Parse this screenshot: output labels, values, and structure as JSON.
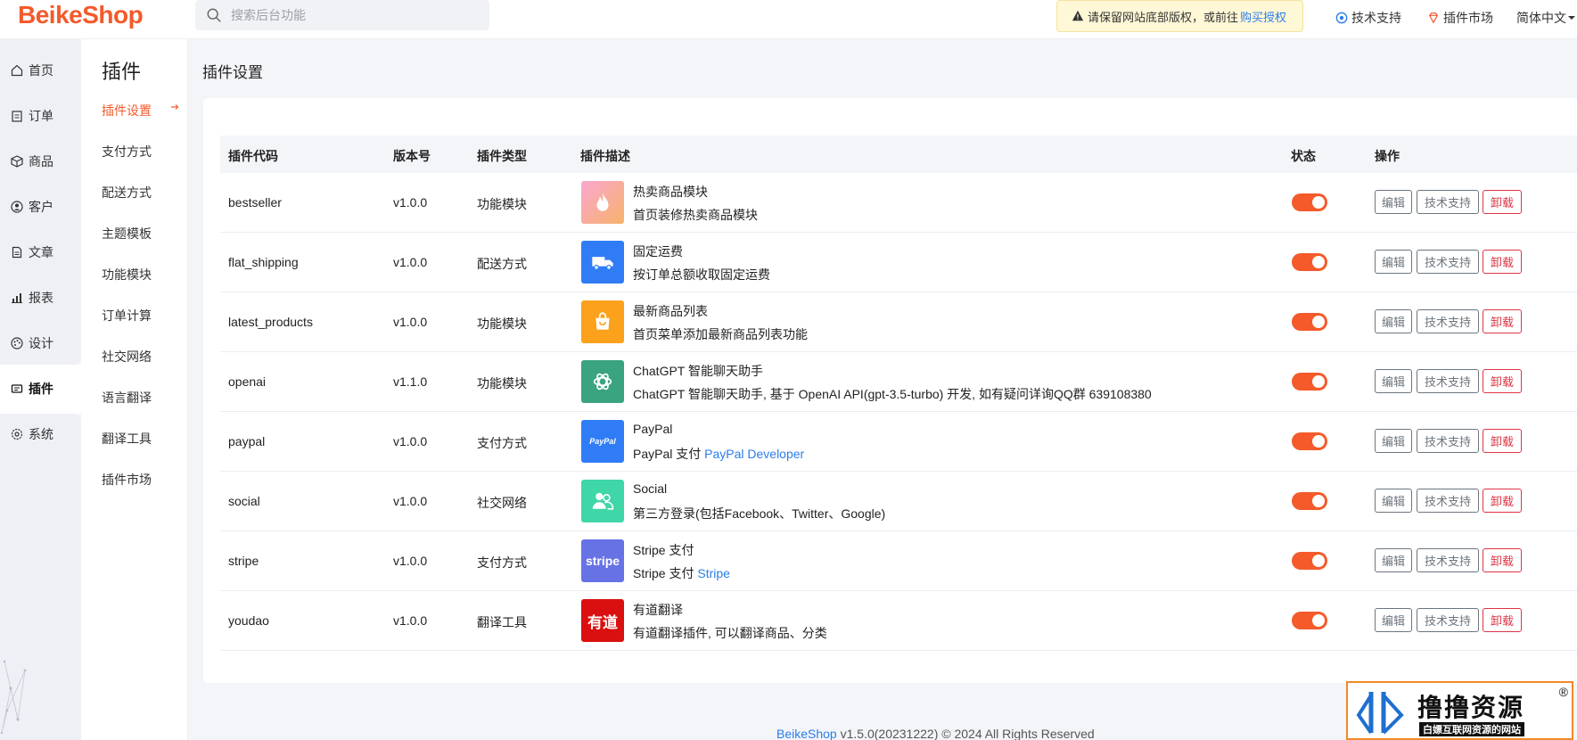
{
  "header": {
    "logo": "BeikeShop",
    "search_placeholder": "搜索后台功能",
    "notice_text": "请保留网站底部版权，或前往",
    "notice_link": "购买授权",
    "support": "技术支持",
    "market": "插件市场",
    "language": "简体中文"
  },
  "sidebar": {
    "items": [
      {
        "label": "首页",
        "icon": "home-icon"
      },
      {
        "label": "订单",
        "icon": "clipboard-icon"
      },
      {
        "label": "商品",
        "icon": "box-icon"
      },
      {
        "label": "客户",
        "icon": "user-icon"
      },
      {
        "label": "文章",
        "icon": "document-icon"
      },
      {
        "label": "报表",
        "icon": "bar-chart-icon"
      },
      {
        "label": "设计",
        "icon": "palette-icon"
      },
      {
        "label": "插件",
        "icon": "plugin-icon"
      },
      {
        "label": "系统",
        "icon": "gear-icon"
      }
    ],
    "active": "插件"
  },
  "subnav": {
    "title": "插件",
    "items": [
      "插件设置",
      "支付方式",
      "配送方式",
      "主题模板",
      "功能模块",
      "订单计算",
      "社交网络",
      "语言翻译",
      "翻译工具",
      "插件市场"
    ],
    "active": "插件设置"
  },
  "page": {
    "title": "插件设置"
  },
  "table": {
    "headers": [
      "插件代码",
      "版本号",
      "插件类型",
      "插件描述",
      "状态",
      "操作"
    ],
    "rows": [
      {
        "code": "bestseller",
        "version": "v1.0.0",
        "type": "功能模块",
        "name": "热卖商品模块",
        "desc": "首页装修热卖商品模块",
        "link": "",
        "icon": "fire-icon",
        "enabled": true
      },
      {
        "code": "flat_shipping",
        "version": "v1.0.0",
        "type": "配送方式",
        "name": "固定运费",
        "desc": "按订单总额收取固定运费",
        "link": "",
        "icon": "truck-icon",
        "enabled": true
      },
      {
        "code": "latest_products",
        "version": "v1.0.0",
        "type": "功能模块",
        "name": "最新商品列表",
        "desc": "首页菜单添加最新商品列表功能",
        "link": "",
        "icon": "shopping-bag-icon",
        "enabled": true
      },
      {
        "code": "openai",
        "version": "v1.1.0",
        "type": "功能模块",
        "name": "ChatGPT 智能聊天助手",
        "desc": "ChatGPT 智能聊天助手, 基于 OpenAI API(gpt-3.5-turbo) 开发, 如有疑问详询QQ群 639108380",
        "link": "",
        "icon": "openai-icon",
        "enabled": true
      },
      {
        "code": "paypal",
        "version": "v1.0.0",
        "type": "支付方式",
        "name": "PayPal",
        "desc": "PayPal 支付 ",
        "link": "PayPal Developer",
        "icon": "paypal-icon",
        "enabled": true
      },
      {
        "code": "social",
        "version": "v1.0.0",
        "type": "社交网络",
        "name": "Social",
        "desc": "第三方登录(包括Facebook、Twitter、Google)",
        "link": "",
        "icon": "users-icon",
        "enabled": true
      },
      {
        "code": "stripe",
        "version": "v1.0.0",
        "type": "支付方式",
        "name": "Stripe 支付",
        "desc": "Stripe 支付 ",
        "link": "Stripe",
        "icon": "stripe-icon",
        "enabled": true
      },
      {
        "code": "youdao",
        "version": "v1.0.0",
        "type": "翻译工具",
        "name": "有道翻译",
        "desc": "有道翻译插件, 可以翻译商品、分类",
        "link": "",
        "icon": "youdao-icon",
        "enabled": true
      }
    ],
    "actions": {
      "edit": "编辑",
      "support": "技术支持",
      "uninstall": "卸载"
    }
  },
  "icon_text": {
    "paypal": "PayPal",
    "stripe": "stripe",
    "youdao": "有道"
  },
  "footer": {
    "brand": "BeikeShop",
    "text": " v1.5.0(20231222) © 2024 All Rights Reserved"
  },
  "watermark": {
    "title": "撸撸资源",
    "subtitle": "白嫖互联网资源的网站",
    "reg": "®"
  },
  "colors": {
    "accent": "#f45a2a",
    "link": "#2b7de9",
    "danger": "#dc3545"
  }
}
